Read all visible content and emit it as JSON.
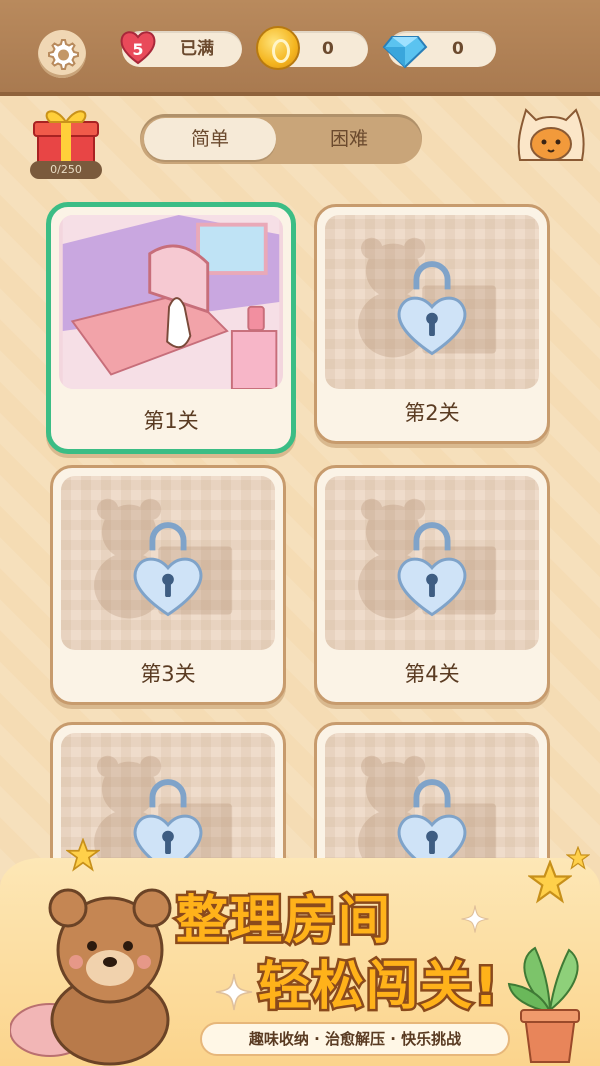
{
  "topbar": {
    "lives": "5",
    "lives_status": "已满",
    "coins": "0",
    "gems": "0"
  },
  "gift": {
    "progress": "0/250"
  },
  "tabs": [
    {
      "label": "简单",
      "selected": true
    },
    {
      "label": "困难",
      "selected": false
    }
  ],
  "levels": [
    {
      "label": "第1关",
      "locked": false
    },
    {
      "label": "第2关",
      "locked": true
    },
    {
      "label": "第3关",
      "locked": true
    },
    {
      "label": "第4关",
      "locked": true
    },
    {
      "label": "",
      "locked": true
    },
    {
      "label": "",
      "locked": true
    }
  ],
  "banner": {
    "title_line1": "整理房间",
    "title_line2": "轻松闯关!",
    "subtitle": "趣味收纳 · 治愈解压 · 快乐挑战"
  },
  "colors": {
    "active_border": "#3bbd85",
    "topbar": "#a97a50",
    "title": "#ffb21a"
  }
}
